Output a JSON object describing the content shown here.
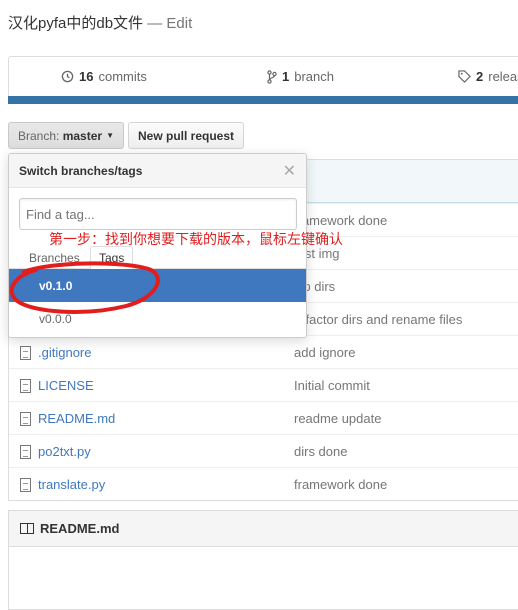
{
  "repo": {
    "title": "汉化pyfa中的db文件",
    "separator": " — ",
    "edit": "Edit"
  },
  "summary": {
    "commits": {
      "count": "16",
      "label": "commits",
      "icon": "history-icon"
    },
    "branches": {
      "count": "1",
      "label": "branch",
      "icon": "branch-icon"
    },
    "releases": {
      "count": "2",
      "label": "releases",
      "icon": "tag-icon"
    }
  },
  "toolbar": {
    "branch_prefix": "Branch:",
    "branch_value": "master",
    "new_pr": "New pull request"
  },
  "dropdown": {
    "title": "Switch branches/tags",
    "filter_placeholder": "Find a tag...",
    "tabs": [
      "Branches",
      "Tags"
    ],
    "active_tab": "Tags",
    "items": [
      {
        "name": "v0.1.0",
        "selected": true
      },
      {
        "name": "v0.0.0",
        "selected": false
      }
    ]
  },
  "files": [
    {
      "name": "",
      "message": "framework done"
    },
    {
      "name": "",
      "message": "test img"
    },
    {
      "name": "",
      "message": "zip dirs"
    },
    {
      "name": "",
      "message": "refactor dirs and rename files"
    },
    {
      "name": ".gitignore",
      "message": "add ignore"
    },
    {
      "name": "LICENSE",
      "message": "Initial commit"
    },
    {
      "name": "README.md",
      "message": "readme update"
    },
    {
      "name": "po2txt.py",
      "message": "dirs done"
    },
    {
      "name": "translate.py",
      "message": "framework done"
    }
  ],
  "readme": {
    "title": "README.md"
  },
  "annotation": {
    "text": "第一步：找到你想要下载的版本，鼠标左键确认",
    "color": "#e01e1e"
  },
  "colors": {
    "accent": "#4078c0",
    "language_bar": "#3572a5"
  }
}
